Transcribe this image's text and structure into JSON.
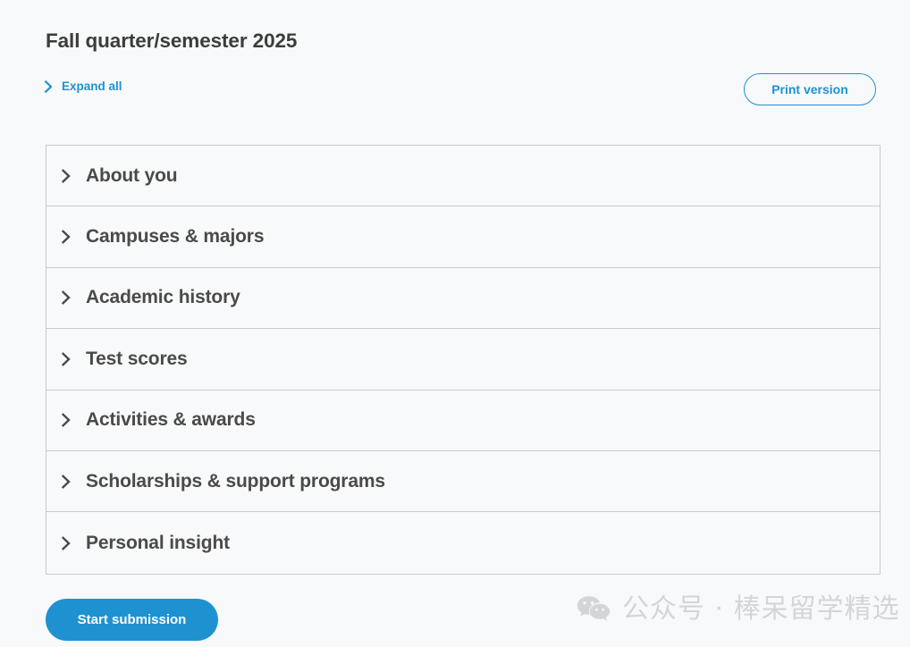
{
  "header": {
    "title": "Fall quarter/semester 2025",
    "expand_all": {
      "label": "Expand all",
      "icon": "chevron-right-icon"
    },
    "print_button": {
      "label": "Print version"
    }
  },
  "accordion": {
    "sections": [
      {
        "label": "About you",
        "icon": "chevron-right-icon"
      },
      {
        "label": "Campuses & majors",
        "icon": "chevron-right-icon"
      },
      {
        "label": "Academic history",
        "icon": "chevron-right-icon"
      },
      {
        "label": "Test scores",
        "icon": "chevron-right-icon"
      },
      {
        "label": "Activities & awards",
        "icon": "chevron-right-icon"
      },
      {
        "label": "Scholarships & support programs",
        "icon": "chevron-right-icon"
      },
      {
        "label": "Personal insight",
        "icon": "chevron-right-icon"
      }
    ]
  },
  "footer": {
    "start_button": {
      "label": "Start submission"
    },
    "watermark": {
      "icon": "wechat-logo-icon",
      "text": "公众号 · 棒呆留学精选"
    }
  },
  "colors": {
    "accent_blue": "#1e92d1",
    "page_background": "#f7f9fa",
    "panel_background": "#f8f9fa",
    "border_gray": "#c8cccf",
    "heading_text": "#3c3c3b",
    "section_text": "#4a4a48",
    "watermark_gray": "#d3d6d8"
  }
}
